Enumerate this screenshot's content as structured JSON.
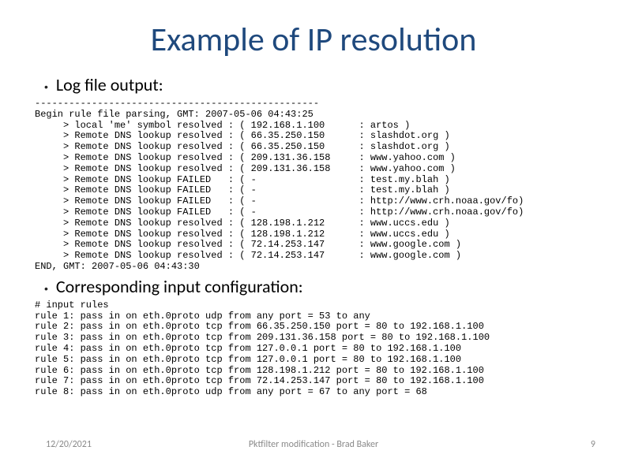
{
  "title": "Example of IP resolution",
  "bullets": {
    "b1": "Log file output:",
    "b2": "Corresponding input configuration:"
  },
  "log": {
    "divider": "--------------------------------------------------",
    "begin": "Begin rule file parsing, GMT: 2007-05-06 04:43:25",
    "rows": [
      "     > local 'me' symbol resolved : ( 192.168.1.100      : artos )",
      "     > Remote DNS lookup resolved : ( 66.35.250.150      : slashdot.org )",
      "     > Remote DNS lookup resolved : ( 66.35.250.150      : slashdot.org )",
      "     > Remote DNS lookup resolved : ( 209.131.36.158     : www.yahoo.com )",
      "     > Remote DNS lookup resolved : ( 209.131.36.158     : www.yahoo.com )",
      "     > Remote DNS lookup FAILED   : ( -                  : test.my.blah )",
      "     > Remote DNS lookup FAILED   : ( -                  : test.my.blah )",
      "     > Remote DNS lookup FAILED   : ( -                  : http://www.crh.noaa.gov/fo)",
      "     > Remote DNS lookup FAILED   : ( -                  : http://www.crh.noaa.gov/fo)",
      "     > Remote DNS lookup resolved : ( 128.198.1.212      : www.uccs.edu )",
      "     > Remote DNS lookup resolved : ( 128.198.1.212      : www.uccs.edu )",
      "     > Remote DNS lookup resolved : ( 72.14.253.147      : www.google.com )",
      "     > Remote DNS lookup resolved : ( 72.14.253.147      : www.google.com )"
    ],
    "end": "END, GMT: 2007-05-06 04:43:30"
  },
  "config": {
    "header": "# input rules",
    "rules": [
      "rule 1: pass in on eth.0proto udp from any port = 53 to any",
      "rule 2: pass in on eth.0proto tcp from 66.35.250.150 port = 80 to 192.168.1.100",
      "rule 3: pass in on eth.0proto tcp from 209.131.36.158 port = 80 to 192.168.1.100",
      "rule 4: pass in on eth.0proto tcp from 127.0.0.1 port = 80 to 192.168.1.100",
      "rule 5: pass in on eth.0proto tcp from 127.0.0.1 port = 80 to 192.168.1.100",
      "rule 6: pass in on eth.0proto tcp from 128.198.1.212 port = 80 to 192.168.1.100",
      "rule 7: pass in on eth.0proto tcp from 72.14.253.147 port = 80 to 192.168.1.100",
      "rule 8: pass in on eth.0proto udp from any port = 67 to any port = 68"
    ]
  },
  "footer": {
    "date": "12/20/2021",
    "mid": "Pktfilter modification - Brad Baker",
    "page": "9"
  }
}
